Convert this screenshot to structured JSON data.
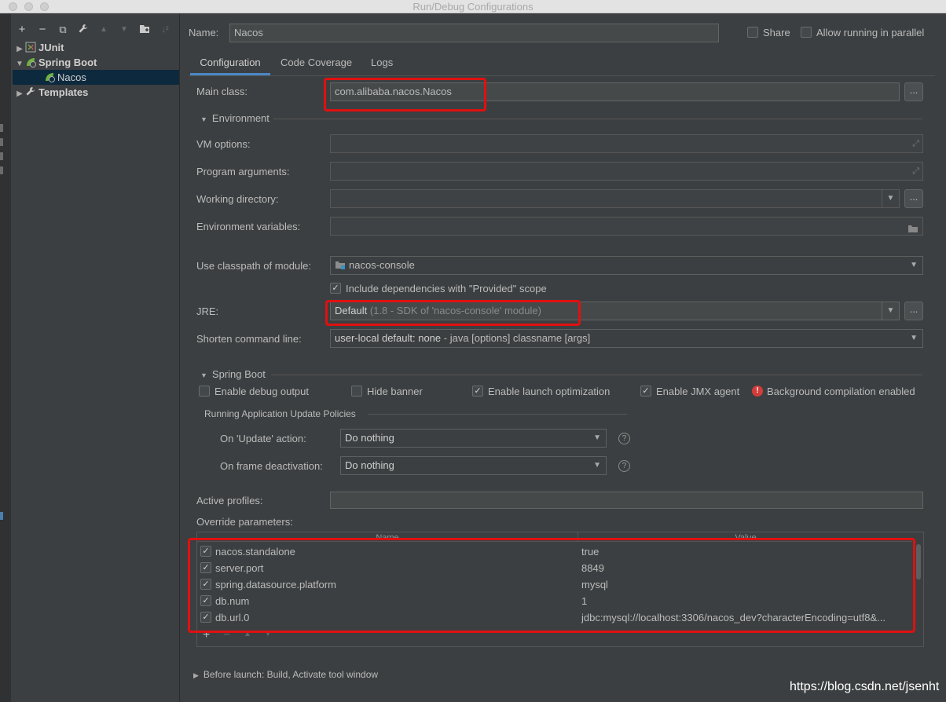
{
  "window": {
    "title": "Run/Debug Configurations"
  },
  "toolbar": {
    "add": "+",
    "remove": "−",
    "copy": "⧉",
    "edit_defaults": "🔧",
    "move_up": "▲",
    "move_down": "▼",
    "folder": "📁",
    "sort": "↓²"
  },
  "tree": {
    "junit": "JUnit",
    "spring_boot": "Spring Boot",
    "nacos": "Nacos",
    "templates": "Templates"
  },
  "header": {
    "name_label": "Name:",
    "name_value": "Nacos",
    "share_label": "Share",
    "allow_parallel_label": "Allow running in parallel"
  },
  "tabs": [
    "Configuration",
    "Code Coverage",
    "Logs"
  ],
  "config": {
    "main_class_label": "Main class:",
    "main_class_value": "com.alibaba.nacos.Nacos",
    "environment_title": "Environment",
    "vm_options_label": "VM options:",
    "program_args_label": "Program arguments:",
    "working_dir_label": "Working directory:",
    "env_vars_label": "Environment variables:",
    "classpath_label": "Use classpath of module:",
    "classpath_value": "nacos-console",
    "include_deps_label": "Include dependencies with \"Provided\" scope",
    "jre_label": "JRE:",
    "jre_value": "Default",
    "jre_hint": "(1.8 - SDK of 'nacos-console' module)",
    "shorten_label": "Shorten command line:",
    "shorten_value": "user-local default: none",
    "shorten_hint": " - java [options] classname [args]",
    "dots": "..."
  },
  "spring_boot": {
    "title": "Spring Boot",
    "debug_output": "Enable debug output",
    "hide_banner": "Hide banner",
    "launch_opt": "Enable launch optimization",
    "jmx_agent": "Enable JMX agent",
    "bg_compilation": "Background compilation enabled",
    "policies_title": "Running Application Update Policies",
    "on_update_label": "On 'Update' action:",
    "on_update_value": "Do nothing",
    "on_frame_label": "On frame deactivation:",
    "on_frame_value": "Do nothing",
    "active_profiles_label": "Active profiles:",
    "override_label": "Override parameters:"
  },
  "params_table": {
    "col_name": "Name",
    "col_value": "Value",
    "rows": [
      {
        "name": "nacos.standalone",
        "value": "true"
      },
      {
        "name": "server.port",
        "value": "8849"
      },
      {
        "name": "spring.datasource.platform",
        "value": "mysql"
      },
      {
        "name": "db.num",
        "value": "1"
      },
      {
        "name": "db.url.0",
        "value": "jdbc:mysql://localhost:3306/nacos_dev?characterEncoding=utf8&..."
      }
    ]
  },
  "before_launch": "Before launch: Build, Activate tool window",
  "watermark": "https://blog.csdn.net/jsenht",
  "colors": {
    "accent": "#4a88c7",
    "highlight": "#e01010",
    "selection": "#0d293e"
  }
}
